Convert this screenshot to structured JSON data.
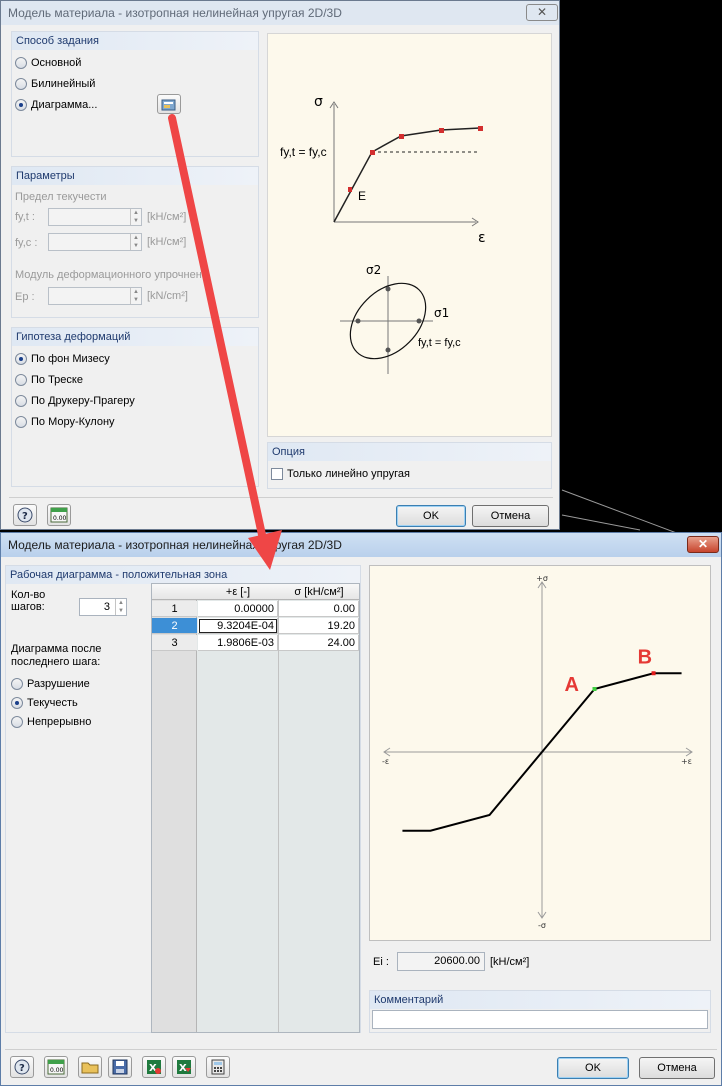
{
  "dialog1": {
    "title": "Модель материала - изотропная нелинейная упругая 2D/3D",
    "close": "✕",
    "method_group": {
      "title": "Способ задания",
      "options": [
        "Основной",
        "Билинейный",
        "Диаграмма..."
      ],
      "selected": 2
    },
    "params_group": {
      "title": "Параметры",
      "yield_label": "Предел текучести",
      "fyt_label": "fy,t :",
      "fyc_label": "fy,c :",
      "unit_kn_cm2_1": "[kH/см²]",
      "unit_kn_cm2_2": "[kH/см²]",
      "hardening_label": "Модуль деформационного упрочнения",
      "ep_label": "Ep :",
      "unit_kn_cm2_3": "[kN/cm²]"
    },
    "hypothesis_group": {
      "title": "Гипотеза деформаций",
      "options": [
        "По фон Мизесу",
        "По Треске",
        "По Друкеру-Прагеру",
        "По Мору-Кулону"
      ],
      "selected": 0
    },
    "illustration": {
      "sigma": "σ",
      "eps": "ε",
      "fy_label": "fy,t = fy,c",
      "e_label": "E",
      "sigma2": "σ2",
      "sigma1": "σ1",
      "fy_label2": "fy,t = fy,c"
    },
    "option_group": {
      "title": "Опция",
      "checkbox": "Только линейно упругая"
    },
    "ok": "OK",
    "cancel": "Отмена"
  },
  "dialog2": {
    "title": "Модель материала - изотропная нелинейная упругая 2D/3D",
    "close": "✕",
    "panel_title": "Рабочая диаграмма - положительная зона",
    "steps_label_1": "Кол-во",
    "steps_label_2": "шагов:",
    "steps_value": "3",
    "after_label_1": "Диаграмма после",
    "after_label_2": "последнего шага:",
    "after_options": [
      "Разрушение",
      "Текучесть",
      "Непрерывно"
    ],
    "after_selected": 1,
    "table": {
      "headers": [
        "+ε [-]",
        "σ [kH/см²]"
      ],
      "rows": [
        {
          "n": "1",
          "eps": "0.00000",
          "sigma": "0.00"
        },
        {
          "n": "2",
          "eps": "9.3204E-04",
          "sigma": "19.20"
        },
        {
          "n": "3",
          "eps": "1.9806E-03",
          "sigma": "24.00"
        }
      ]
    },
    "chart": {
      "plus_sigma": "+σ",
      "minus_sigma": "-σ",
      "minus_eps": "-ε",
      "plus_eps": "+ε",
      "label_a": "A",
      "label_b": "B",
      "a_color": "#e53935",
      "b_color": "#e53935"
    },
    "ei_label": "Ei :",
    "ei_value": "20600.00",
    "ei_unit": "[kH/см²]",
    "comment_title": "Комментарий",
    "ok": "OK",
    "cancel": "Отмена"
  },
  "chart_data": {
    "type": "line",
    "title": "",
    "x": [
      -0.0019806,
      -0.00093204,
      0,
      0.00093204,
      0.0019806
    ],
    "series": [
      {
        "values": [
          -24.0,
          -19.2,
          0,
          19.2,
          24.0
        ]
      }
    ]
  },
  "accent_colors": {
    "arrow": "#ef4646",
    "point_a": "#3ecf3e",
    "point_b": "#e31b1b"
  }
}
